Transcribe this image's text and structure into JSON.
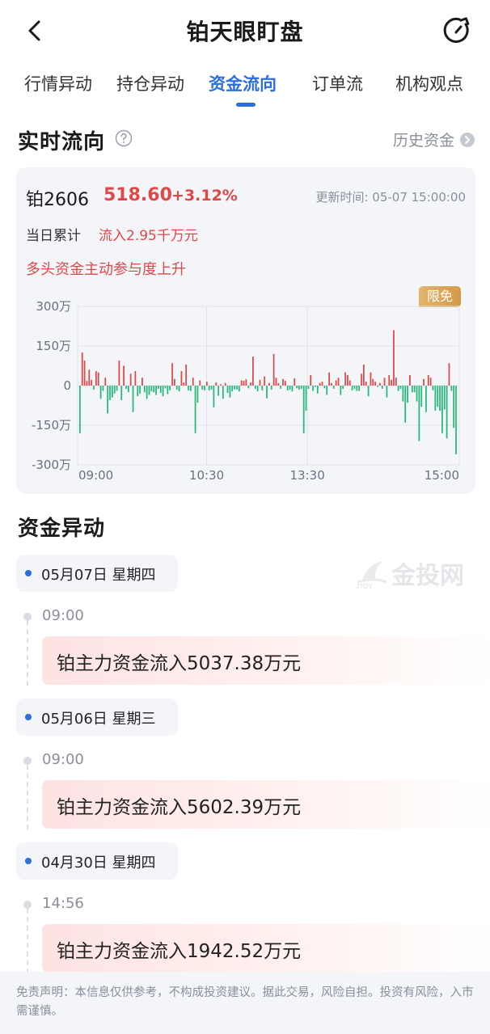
{
  "header": {
    "title": "铂天眼盯盘",
    "back_icon": "chevron-left-icon",
    "refresh_icon": "refresh-icon"
  },
  "tabs": [
    {
      "label": "行情异动",
      "active": false
    },
    {
      "label": "持仓异动",
      "active": false
    },
    {
      "label": "资金流向",
      "active": true
    },
    {
      "label": "订单流",
      "active": false
    },
    {
      "label": "机构观点",
      "active": false
    }
  ],
  "realtime": {
    "title": "实时流向",
    "help_icon": "question-circle-icon",
    "history_label": "历史资金",
    "card": {
      "symbol": "铂2606",
      "price": "518.60",
      "change_pct": "+3.12%",
      "update_time": "更新时间: 05-07 15:00:00",
      "cumulative_label": "当日累计",
      "cumulative_value": "流入2.95千万元",
      "description": "多头资金主动参与度上升",
      "badge": "限免"
    }
  },
  "chart_data": {
    "type": "bar",
    "title": "",
    "xlabel": "",
    "ylabel": "",
    "yunit": "万",
    "ylim": [
      -300,
      300
    ],
    "y_ticks": [
      "300万",
      "150万",
      "0",
      "-150万",
      "-300万"
    ],
    "x_ticks": [
      "09:00",
      "10:30",
      "13:30",
      "15:00"
    ],
    "grid": true,
    "colors": {
      "positive": "#e04848",
      "negative": "#28b77a"
    },
    "values": [
      -180,
      125,
      95,
      18,
      60,
      22,
      -15,
      55,
      50,
      -50,
      -20,
      30,
      -105,
      -55,
      -45,
      -30,
      -20,
      95,
      -55,
      75,
      -12,
      -25,
      45,
      -100,
      55,
      -40,
      -30,
      30,
      -25,
      -50,
      -35,
      -22,
      -25,
      -35,
      -12,
      -28,
      -40,
      -10,
      -32,
      -18,
      85,
      25,
      -15,
      -22,
      55,
      12,
      80,
      -18,
      -20,
      30,
      -180,
      -65,
      20,
      -15,
      -18,
      15,
      -18,
      -15,
      -82,
      12,
      -38,
      5,
      -50,
      10,
      -28,
      -45,
      -22,
      -14,
      -15,
      -22,
      20,
      18,
      24,
      -10,
      12,
      110,
      -12,
      -22,
      22,
      -18,
      35,
      -48,
      10,
      -15,
      120,
      30,
      10,
      -12,
      25,
      18,
      -18,
      -15,
      -22,
      28,
      -10,
      -15,
      -12,
      -180,
      -95,
      -12,
      40,
      -20,
      -5,
      -30,
      10,
      15,
      -10,
      -35,
      50,
      10,
      -12,
      20,
      30,
      -35,
      -12,
      50,
      40,
      20,
      -18,
      -12,
      -20,
      -20,
      45,
      80,
      15,
      -40,
      50,
      25,
      15,
      -5,
      10,
      -12,
      30,
      -45,
      40,
      22,
      210,
      30,
      -20,
      -12,
      -60,
      -140,
      -65,
      40,
      -25,
      -25,
      -60,
      -210,
      -80,
      25,
      -100,
      40,
      30,
      -18,
      -95,
      -80,
      -95,
      -180,
      -90,
      -200,
      85,
      -20,
      -160,
      -260
    ]
  },
  "anomaly": {
    "title": "资金异动",
    "groups": [
      {
        "date": "05月07日  星期四",
        "time": "09:00",
        "text": "铂主力资金流入5037.38万元"
      },
      {
        "date": "05月06日  星期三",
        "time": "09:00",
        "text": "铂主力资金流入5602.39万元"
      },
      {
        "date": "04月30日  星期四",
        "time": "14:56",
        "text": "铂主力资金流入1942.52万元"
      }
    ]
  },
  "watermark": {
    "text": "金投网",
    "small_text": "JTOY"
  },
  "disclaimer": "免责声明：本信息仅供参考，不构成投资建议。据此交易，风险自担。投资有风险，入市需谨慎。"
}
